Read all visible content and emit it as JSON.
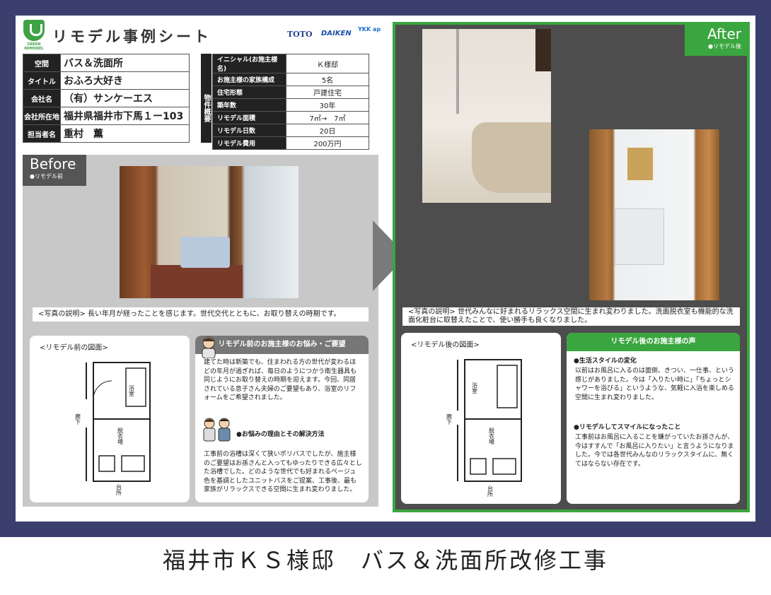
{
  "header": {
    "logo_text": "GREEN REMODEL",
    "title": "リモデル事例シート",
    "brands": [
      "TOTO",
      "DAIKEN",
      "YKK ap"
    ]
  },
  "info_left": [
    {
      "key": "空間",
      "value": "バス＆洗面所"
    },
    {
      "key": "タイトル",
      "value": "おふろ大好き"
    },
    {
      "key": "会社名",
      "value": "（有）サンケーエス"
    },
    {
      "key": "会社所在地",
      "value": "福井県福井市下馬１ー103"
    },
    {
      "key": "担当者名",
      "value": "重村　薫"
    }
  ],
  "info_right_label": "物件概要",
  "info_right": [
    {
      "key": "イニシャル(お施主様名)",
      "value": "Ｋ様邸"
    },
    {
      "key": "お施主様の家族構成",
      "value": "5名"
    },
    {
      "key": "住宅形態",
      "value": "戸建住宅"
    },
    {
      "key": "築年数",
      "value": "30年"
    },
    {
      "key": "リモデル面積",
      "value": "7㎡→　7㎡"
    },
    {
      "key": "リモデル日数",
      "value": "20日"
    },
    {
      "key": "リモデル費用",
      "value": "200万円"
    }
  ],
  "before": {
    "tag": "Before",
    "tag_sub": "●リモデル前",
    "caption_label": "<写真の説明>",
    "caption": "長い年月が経ったことを感じます。世代交代とともに、お取り替えの時期です。",
    "plan_title": "<リモデル前の図面>",
    "plan_labels": {
      "bath": "浴室",
      "dressing": "脱衣場",
      "hall": "廊下",
      "kitchen": "台所"
    },
    "voice_head": "リモデル前のお施主様のお悩み・ご要望",
    "voice_text": "建てた時は新築でも、住まわれる方の世代が変わるほどの年月が過ぎれば、毎日のようにつかう衛生器具も同じようにお取り替えの時期を迎えます。今回、同居されている息子さん夫婦のご要望もあり、浴室のリフォームをご希望されました。",
    "reason_head": "●お悩みの理由とその解決方法",
    "reason_text": "工事前の浴槽は深くて狭いポリバスでしたが、施主様のご要望はお孫さんと入ってもゆったりできる広々とした浴槽でした。どのような世代でも好まれるベージュ色を基調としたユニットバスをご提案、工事後、最も家族がリラックスできる空間に生まれ変わりました。"
  },
  "after": {
    "tag": "After",
    "tag_sub": "●リモデル後",
    "caption_label": "<写真の説明>",
    "caption": "世代みんなに好まれるリラックス空間に生まれ変わりました。洗面脱衣室も機能的な洗面化粧台に取替えたことで、使い勝手も良くなりました。",
    "plan_title": "<リモデル後の図面>",
    "plan_labels": {
      "bath": "浴室",
      "dressing": "脱衣場",
      "hall": "廊下",
      "kitchen": "台所"
    },
    "voice_head": "リモデル後のお施主様の声",
    "sub1_head": "●生活スタイルの変化",
    "sub1_text": "以前はお風呂に入るのは面倒、きつい、一仕事、という感じがありました。今は「入りたい時に」「ちょっとシャワーを浴びる」というような、気軽に入浴を楽しめる空間に生まれ変わりました。",
    "sub2_head": "●リモデルしてスマイルになったこと",
    "sub2_text": "工事前はお風呂に入ることを嫌がっていたお孫さんが、今はすすんで「お風呂に入りたい」と言うようになりました。今では各世代みんなのリラックスタイムに、無くてはならない存在です。"
  },
  "bottom_title": "福井市ＫＳ様邸　バス＆洗面所改修工事",
  "colors": {
    "frame": "#3b3f6e",
    "green": "#3aa63f",
    "dark": "#4d4d4d",
    "gray": "#c8c8c8",
    "voice_gray": "#777777"
  }
}
